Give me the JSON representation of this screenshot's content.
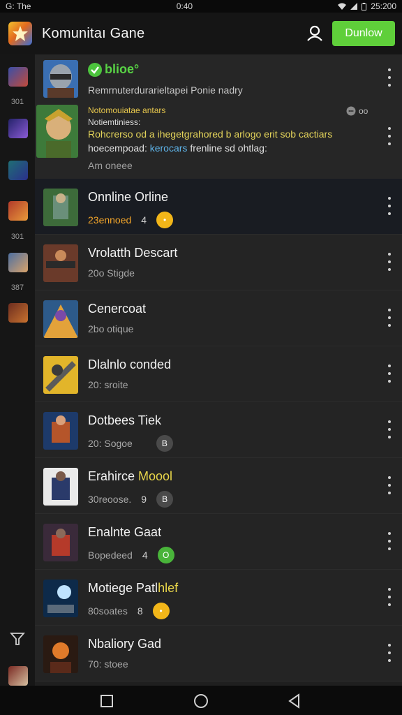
{
  "status_bar": {
    "left": "G: The",
    "time": "0:40",
    "clock": "25:200"
  },
  "header": {
    "title": "Komunitaı Gane",
    "download_label": "Dunlow"
  },
  "rail": {
    "numbers": [
      "301",
      "301",
      "387"
    ]
  },
  "post": {
    "status": "blioe°",
    "description": "Remrnuterdurarieltapei Ponie nadry",
    "author_line": "Notomouiatae antars",
    "author_sub": "Notiemtiniess:",
    "body_line1": "Rohcrerso od a ihegetgrahored b arlogo erit sob cactiars",
    "body_line2_prefix": "hoecempoad:",
    "body_line2_link": "kerocars",
    "body_line2_suffix": "frenline sd ohtlag:",
    "footer": "Am oneee",
    "reply_count": "oo"
  },
  "rows": [
    {
      "title": "Onnline Orline",
      "title_highlight": "",
      "subtitle": "23ennoed",
      "count": "4",
      "badge": "yellow",
      "badge_glyph": "•",
      "active": true,
      "subtitle_orange": true
    },
    {
      "title": "Vrolatth Descart",
      "title_highlight": "",
      "subtitle": "20o Stigde",
      "count": "",
      "badge": "",
      "badge_glyph": "",
      "active": false,
      "subtitle_orange": false
    },
    {
      "title": "Cenercoat",
      "title_highlight": "",
      "subtitle": "2bo otique",
      "count": "",
      "badge": "",
      "badge_glyph": "",
      "active": false,
      "subtitle_orange": false
    },
    {
      "title": "Dlalnlo conded",
      "title_highlight": "",
      "subtitle": "20: sroite",
      "count": "",
      "badge": "",
      "badge_glyph": "",
      "active": false,
      "subtitle_orange": false
    },
    {
      "title": "Dotbees Tiek",
      "title_highlight": "",
      "subtitle": "20: Sogoe",
      "count": "",
      "badge": "grey",
      "badge_glyph": "B",
      "active": false,
      "subtitle_orange": false
    },
    {
      "title": "Erahirce ",
      "title_highlight": "Moool",
      "subtitle": "30reoose.",
      "count": "9",
      "badge": "grey",
      "badge_glyph": "B",
      "active": false,
      "subtitle_orange": false
    },
    {
      "title": "Enalnte Gaat",
      "title_highlight": "",
      "subtitle": "Bopedeed",
      "count": "4",
      "badge": "green",
      "badge_glyph": "O",
      "active": false,
      "subtitle_orange": false
    },
    {
      "title": "Motiege Patl",
      "title_highlight": "hlef",
      "subtitle": "80soates",
      "count": "8",
      "badge": "yellow",
      "badge_glyph": "•",
      "active": false,
      "subtitle_orange": false
    },
    {
      "title": "Nbaliory Gad",
      "title_highlight": "",
      "subtitle": "70: stoee",
      "count": "",
      "badge": "",
      "badge_glyph": "",
      "active": false,
      "subtitle_orange": false
    }
  ],
  "colors": {
    "accent_green": "#5fcf3a",
    "badge_yellow": "#f2b619",
    "link_blue": "#5fb5ea"
  }
}
